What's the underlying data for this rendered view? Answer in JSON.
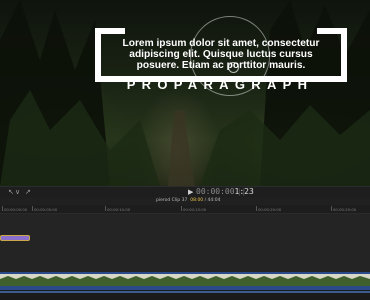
{
  "viewer": {
    "title_text": "Lorem ipsum dolor sit amet, consectetur adipiscing elit. Quisque luctus cursus posuere. Etiam ac porttitor mauris.",
    "title_big": "PROPARAGRAPH"
  },
  "transport": {
    "tool_label": "↖",
    "tool_dropdown": "∨",
    "fx_label": "↗",
    "play_icon": "▶",
    "timecode_dim": "00:00:00",
    "timecode_bright": "1:23",
    "pipes": "| |"
  },
  "timeline": {
    "clip_name": "pierod Clip 37",
    "clip_duration": "08:00",
    "clip_total": "/ 44:04",
    "ruler_ticks": [
      "00:00:00:00",
      "00:00:05:00",
      "00:00:10:00",
      "00:00:15:00",
      "00:00:20:00",
      "00:00:25:00"
    ]
  },
  "colors": {
    "title_clip": "#8b6fcf",
    "storyline": "#2a4a8a",
    "accent_timecode": "#e7c24a"
  }
}
